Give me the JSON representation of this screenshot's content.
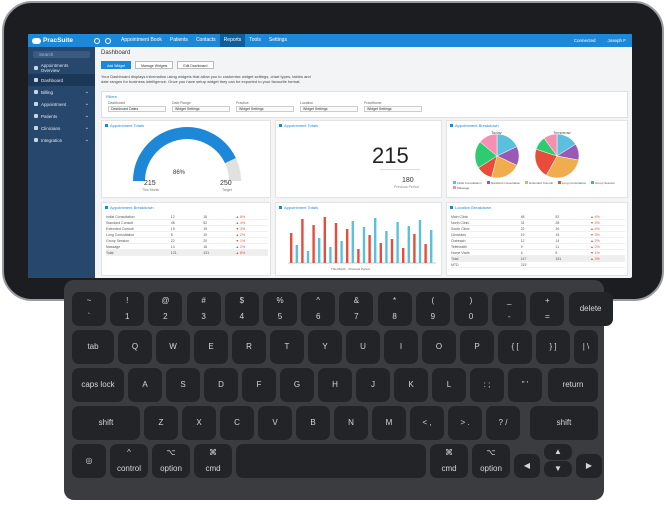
{
  "app": {
    "logo": "PracSuite",
    "menu": [
      "Appointment Book",
      "Patients",
      "Contacts",
      "Reports",
      "Tools",
      "Settings"
    ],
    "active_menu": "Reports",
    "user_right": [
      "Connected",
      "Joseph F"
    ]
  },
  "sidebar": {
    "search_placeholder": "Search",
    "items": [
      {
        "label": "Appointments Overview",
        "chev": ""
      },
      {
        "label": "Dashboard",
        "chev": ""
      },
      {
        "label": "Billing",
        "chev": "⌄"
      },
      {
        "label": "Appointment",
        "chev": "⌄"
      },
      {
        "label": "Patients",
        "chev": "⌄"
      },
      {
        "label": "Clinicians",
        "chev": "⌄"
      },
      {
        "label": "Integration",
        "chev": "⌄"
      }
    ],
    "active_index": 1
  },
  "main": {
    "title": "Dashboard",
    "buttons": [
      "Add Widget",
      "Manage Widgets",
      "Edit Dashboard"
    ],
    "notice": "Your Dashboard displays information using widgets that allow you to customise widget settings, chart types, tables and date ranges for business intelligence. Once you have setup widget they can be exported to your favourite format.",
    "filters": {
      "title": "Filters",
      "items": [
        {
          "label": "Dashboard",
          "value": "Dashboard Dates"
        },
        {
          "label": "Date Range",
          "value": "Widget Settings"
        },
        {
          "label": "Practice",
          "value": "Widget Settings"
        },
        {
          "label": "Location",
          "value": "Widget Settings"
        },
        {
          "label": "Practitioner",
          "value": "Widget Settings"
        }
      ]
    }
  },
  "gauge": {
    "title": "Appointment Totals",
    "percent_label": "86%",
    "fill_fraction": 0.86,
    "left_value": "215",
    "left_caption": "This Month",
    "right_value": "250",
    "right_caption": "Target"
  },
  "kpi": {
    "title": "Appointment Totals",
    "value": "215",
    "sub_value": "180",
    "sub_caption": "Previous Period"
  },
  "pies": {
    "title": "Appointment Breakdown",
    "labels": [
      "Today",
      "Tomorrow"
    ],
    "colors": [
      "#5bc0de",
      "#9b59b6",
      "#f0ad4e",
      "#e74c3c",
      "#2ecc71",
      "#f78fb3"
    ],
    "legend": [
      "Initial Consultation",
      "Standard Consultation",
      "Extended Consult",
      "Long Consultation",
      "Group Session",
      "Massage"
    ]
  },
  "table1": {
    "title": "Appointment Breakdown",
    "rows": [
      [
        "Initial Consultation",
        "12",
        "18",
        "▲ 6%"
      ],
      [
        "Standard Consult",
        "46",
        "52",
        "▲ 4%"
      ],
      [
        "Extended Consult",
        "19",
        "15",
        "▼ 3%"
      ],
      [
        "Long Consultation",
        "8",
        "10",
        "▲ 2%"
      ],
      [
        "Group Session",
        "22",
        "20",
        "▼ 1%"
      ],
      [
        "Massage",
        "14",
        "16",
        "▲ 2%"
      ],
      [
        "Total",
        "121",
        "131",
        "▲ 8%"
      ]
    ]
  },
  "bars": {
    "title": "Appointment Totals",
    "legend": "This Month · Previous Period",
    "colors": [
      "#e74c3c",
      "#5bc0de"
    ]
  },
  "table2": {
    "title": "Location Breakdown",
    "rows": [
      [
        "Main Clinic",
        "48",
        "52",
        "▲ 4%"
      ],
      [
        "North Clinic",
        "31",
        "28",
        "▼ 3%"
      ],
      [
        "South Clinic",
        "22",
        "26",
        "▲ 4%"
      ],
      [
        "Clinicians",
        "19",
        "15",
        "▼ 3%"
      ],
      [
        "Outreach",
        "12",
        "14",
        "▲ 2%"
      ],
      [
        "Telehealth",
        "9",
        "11",
        "▲ 2%"
      ],
      [
        "Home Visits",
        "6",
        "5",
        "▼ 1%"
      ],
      [
        "Total",
        "147",
        "151",
        "▲ 3%"
      ],
      [
        "MTD",
        "215",
        "",
        ""
      ]
    ]
  },
  "keyboard": {
    "row1": [
      [
        "~",
        "`"
      ],
      [
        "!",
        "1"
      ],
      [
        "@",
        "2"
      ],
      [
        "#",
        "3"
      ],
      [
        "$",
        "4"
      ],
      [
        "%",
        "5"
      ],
      [
        "^",
        "6"
      ],
      [
        "&",
        "7"
      ],
      [
        "*",
        "8"
      ],
      [
        "(",
        "9"
      ],
      [
        ")",
        "0"
      ],
      [
        "_",
        "-"
      ],
      [
        "+",
        "="
      ],
      [
        "",
        "delete"
      ]
    ],
    "row2": [
      "tab",
      "Q",
      "W",
      "E",
      "R",
      "T",
      "Y",
      "U",
      "I",
      "O",
      "P",
      "{ [",
      "} ]",
      "| \\"
    ],
    "row3": [
      "caps lock",
      "A",
      "S",
      "D",
      "F",
      "G",
      "H",
      "J",
      "K",
      "L",
      ": ;",
      "\" '",
      "return"
    ],
    "row4": [
      "shift",
      "Z",
      "X",
      "C",
      "V",
      "B",
      "N",
      "M",
      "< ,",
      "> .",
      "? /",
      "shift"
    ],
    "row5": [
      "◎",
      "control",
      "option",
      "cmd",
      "",
      "cmd",
      "option",
      "◀",
      "▲",
      "▼",
      "▶"
    ],
    "row5_icons": [
      "",
      "^",
      "⌥",
      "⌘",
      "",
      "⌘",
      "⌥",
      "",
      "",
      "",
      ""
    ]
  }
}
